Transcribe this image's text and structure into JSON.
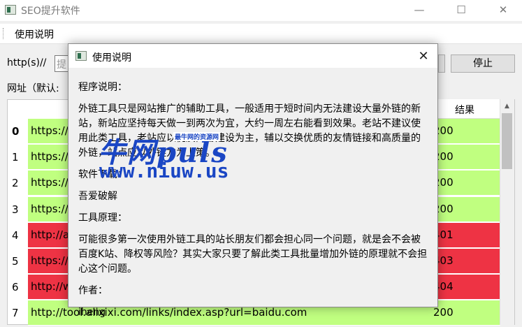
{
  "window": {
    "title": "SEO提升软件",
    "minimize_glyph": "—",
    "maximize_glyph": "☐",
    "close_glyph": "✕"
  },
  "menu": {
    "help": "使用说明"
  },
  "form": {
    "url_label": "http(s)//",
    "url_placeholder": "提",
    "stop_button": "停止",
    "address_label": "网址（默认:"
  },
  "table": {
    "result_header": "结果",
    "rows": [
      {
        "num": "0",
        "url": "https://",
        "result": "200",
        "status": "green"
      },
      {
        "num": "1",
        "url": "https://",
        "result": "200",
        "status": "green"
      },
      {
        "num": "2",
        "url": "https://",
        "result": "200",
        "status": "green"
      },
      {
        "num": "3",
        "url": "https://",
        "result": "200",
        "status": "green"
      },
      {
        "num": "4",
        "url": "http://a",
        "result": "401",
        "status": "red"
      },
      {
        "num": "5",
        "url": "https://",
        "result": "403",
        "status": "red"
      },
      {
        "num": "6",
        "url": "http://w",
        "result": "404",
        "status": "red"
      },
      {
        "num": "7",
        "url": "http://tool.alixixi.com/links/index.asp?url=baidu.com",
        "result": "200",
        "status": "green"
      }
    ]
  },
  "dialog": {
    "title": "使用说明",
    "close_glyph": "✕",
    "sections": [
      {
        "heading": "程序说明：",
        "body": "外链工具只是网站推广的辅助工具，一般适用于短时间内无法建设大量外链的新站，新站应坚持每天做一到两次为宜，大约一周左右能看到效果。老站不建议使用此类工具，老站应以优质内容建设为主，辅以交换优质的友情链接和高质量的外链，站点应以外链方为上策。"
      },
      {
        "heading": "软件下载：",
        "body": "吾爱破解"
      },
      {
        "heading": "工具原理：",
        "body": "可能很多第一次使用外链工具的站长朋友们都会担心同一个问题，就是会不会被百度K站、降权等风险？其实大家只要了解此类工具批量增加外链的原理就不会担心这个问题。"
      },
      {
        "heading": "作者：",
        "body": "iheng"
      }
    ]
  },
  "watermark": {
    "brand": "牛网puls",
    "tagline": "最牛网的资源网",
    "url": "www.niuw.us"
  },
  "colors": {
    "ok_row": "#c0ff80",
    "error_row": "#ee3344",
    "watermark": "#1a46c4"
  }
}
